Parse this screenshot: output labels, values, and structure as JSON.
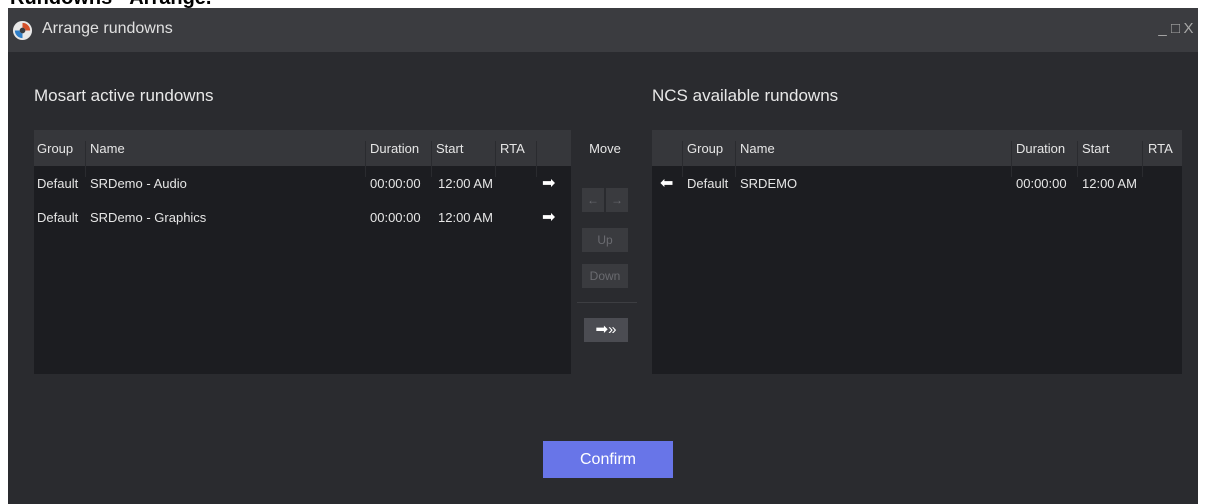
{
  "page_heading": "Rundowns - Arrange.",
  "window": {
    "title": "Arrange rundowns",
    "controls": {
      "minimize": "_",
      "maximize": "□",
      "close": "X"
    }
  },
  "mosart": {
    "title": "Mosart active rundowns",
    "headers": {
      "group": "Group",
      "name": "Name",
      "duration": "Duration",
      "start": "Start",
      "rta": "RTA"
    },
    "rows": [
      {
        "group": "Default",
        "name": "SRDemo - Audio",
        "duration": "00:00:00",
        "start": "12:00 AM",
        "arrow": "➡"
      },
      {
        "group": "Default",
        "name": "SRDemo - Graphics",
        "duration": "00:00:00",
        "start": "12:00 AM",
        "arrow": "➡"
      }
    ]
  },
  "move": {
    "label": "Move",
    "left": "←",
    "right": "→",
    "up": "Up",
    "down": "Down",
    "move_all": "➡»"
  },
  "ncs": {
    "title": "NCS available rundowns",
    "headers": {
      "group": "Group",
      "name": "Name",
      "duration": "Duration",
      "start": "Start",
      "rta": "RTA"
    },
    "rows": [
      {
        "arrow": "⬅",
        "group": "Default",
        "name": "SRDEMO",
        "duration": "00:00:00",
        "start": "12:00 AM"
      }
    ]
  },
  "confirm_label": "Confirm",
  "colors": {
    "accent": "#6875e8",
    "background": "#2a2b2f",
    "titlebar": "#3b3c40",
    "table": "#1c1d21"
  }
}
